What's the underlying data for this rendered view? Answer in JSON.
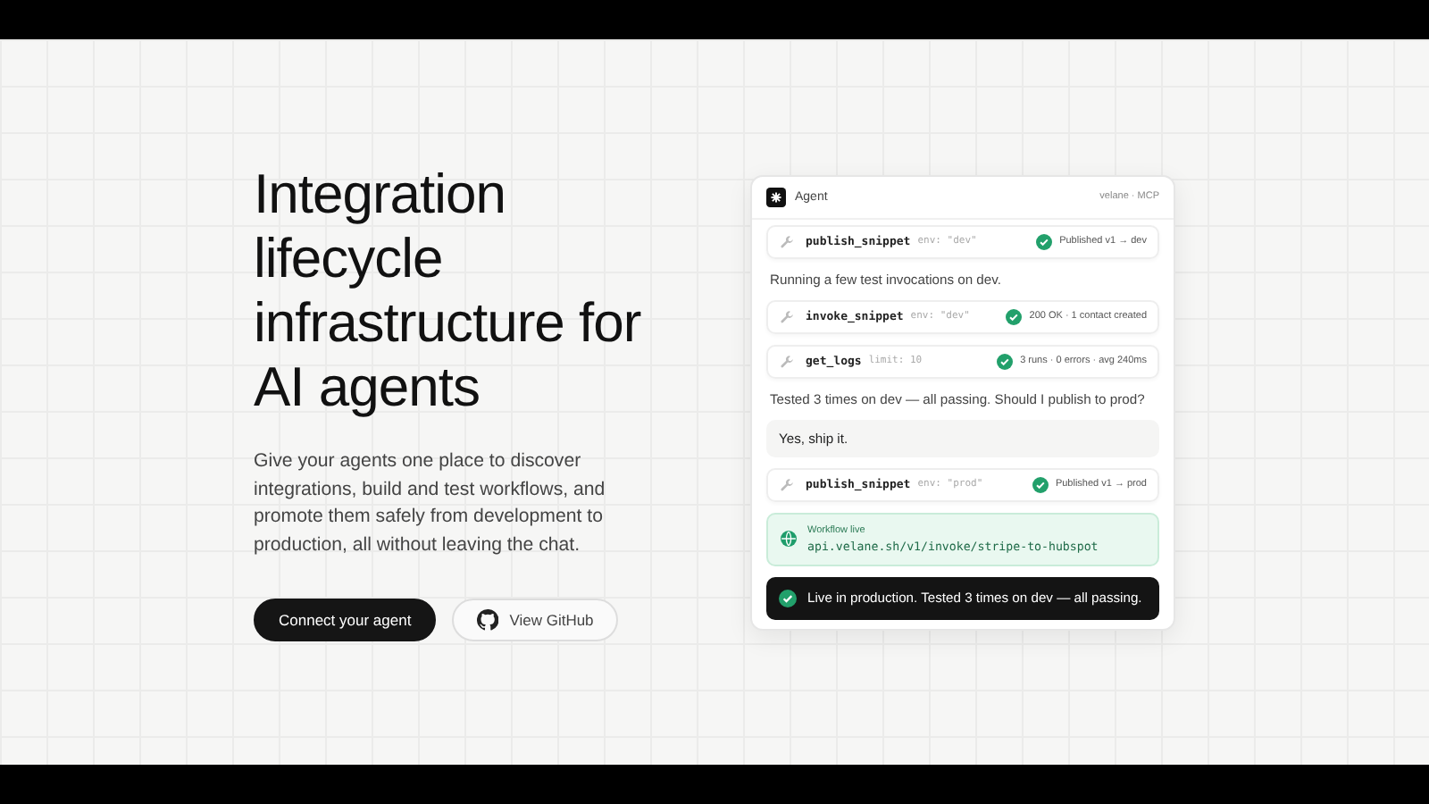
{
  "hero": {
    "title": "Integration lifecycle infrastructure for AI agents",
    "description": "Give your agents one place to discover integrations, build and test workflows, and promote them safely from development to production, all without leaving the chat.",
    "buttons": [
      {
        "kind": "primary",
        "label": "Connect your agent"
      },
      {
        "kind": "github",
        "label": "View GitHub"
      }
    ]
  },
  "agent_panel": {
    "title": "Agent",
    "meta": "velane · MCP",
    "messages": [
      {
        "kind": "tool",
        "name": "publish_snippet",
        "args": "env: \"dev\"",
        "result": "Published v1 → dev"
      },
      {
        "kind": "agent",
        "text": "Running a few test invocations on dev."
      },
      {
        "kind": "tool",
        "name": "invoke_snippet",
        "args": "env: \"dev\"",
        "result": "200 OK · 1 contact created"
      },
      {
        "kind": "tool",
        "name": "get_logs",
        "args": "limit: 10",
        "result": "3 runs · 0 errors · avg 240ms"
      },
      {
        "kind": "agent",
        "text": "Tested 3 times on dev — all passing. Should I publish to prod?"
      },
      {
        "kind": "user",
        "text": "Yes, ship it."
      },
      {
        "kind": "tool",
        "name": "publish_snippet",
        "args": "env: \"prod\"",
        "result": "Published v1 → prod"
      },
      {
        "kind": "link",
        "label": "Workflow live",
        "url": "api.velane.sh/v1/invoke/stripe-to-hubspot"
      },
      {
        "kind": "status",
        "text": "Live in production. Tested 3 times on dev — all passing."
      }
    ]
  }
}
